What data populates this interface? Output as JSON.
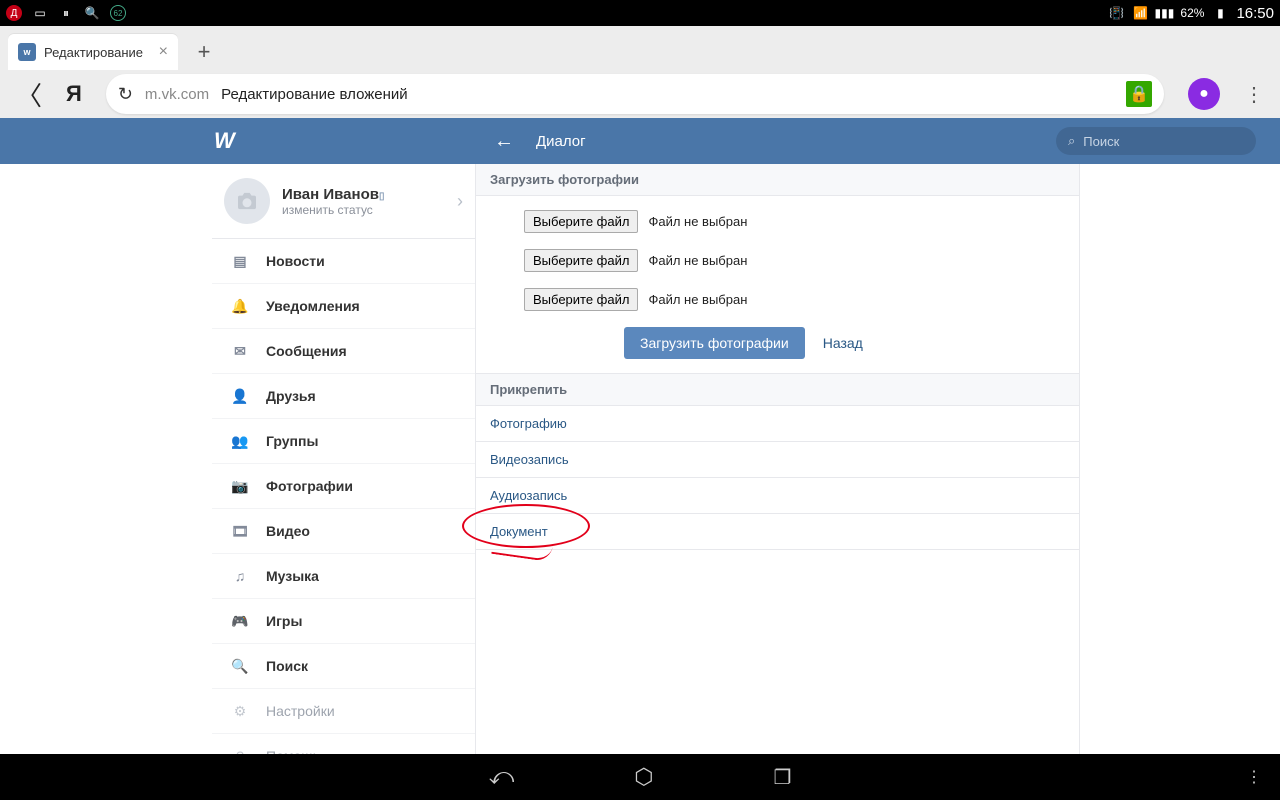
{
  "statusbar": {
    "battery_pct": "62%",
    "time": "16:50"
  },
  "browser": {
    "tab_title": "Редактирование",
    "domain": "m.vk.com",
    "page_title": "Редактирование вложений"
  },
  "vk_header": {
    "title": "Диалог",
    "search_placeholder": "Поиск"
  },
  "profile": {
    "name": "Иван Иванов",
    "status": "изменить статус"
  },
  "sidebar": {
    "items": [
      {
        "label": "Новости"
      },
      {
        "label": "Уведомления"
      },
      {
        "label": "Сообщения"
      },
      {
        "label": "Друзья"
      },
      {
        "label": "Группы"
      },
      {
        "label": "Фотографии"
      },
      {
        "label": "Видео"
      },
      {
        "label": "Музыка"
      },
      {
        "label": "Игры"
      },
      {
        "label": "Поиск"
      },
      {
        "label": "Настройки"
      },
      {
        "label": "Помощь"
      }
    ]
  },
  "content": {
    "upload_heading": "Загрузить фотографии",
    "file_button": "Выберите файл",
    "file_status": "Файл не выбран",
    "submit": "Загрузить фотографии",
    "back": "Назад",
    "attach_heading": "Прикрепить",
    "attach_items": [
      "Фотографию",
      "Видеозапись",
      "Аудиозапись",
      "Документ"
    ]
  }
}
